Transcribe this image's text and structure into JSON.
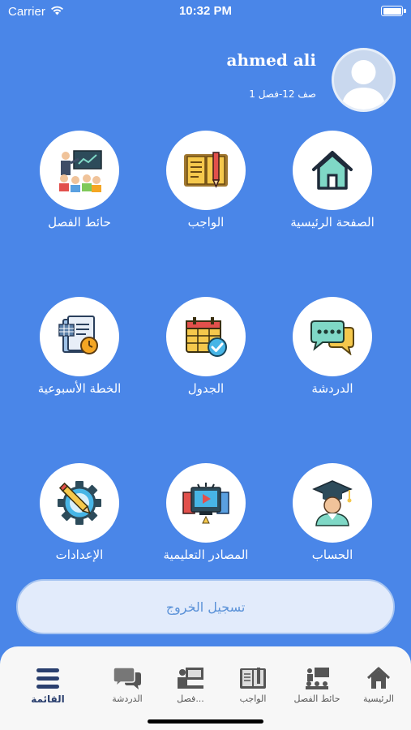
{
  "status_bar": {
    "carrier": "Carrier",
    "time": "10:32 PM"
  },
  "profile": {
    "name": "ahmed ali",
    "class_info": "صف 12-فصل 1"
  },
  "grid": [
    {
      "label": "الصفحة الرئيسية",
      "icon": "home-icon"
    },
    {
      "label": "الواجب",
      "icon": "homework-book-icon"
    },
    {
      "label": "حائط الفصل",
      "icon": "classroom-icon"
    },
    {
      "label": "الدردشة",
      "icon": "chat-icon"
    },
    {
      "label": "الجدول",
      "icon": "calendar-icon"
    },
    {
      "label": "الخطة الأسبوعية",
      "icon": "weekly-plan-icon"
    },
    {
      "label": "الحساب",
      "icon": "graduate-icon"
    },
    {
      "label": "المصادر التعليمية",
      "icon": "learning-resources-icon"
    },
    {
      "label": "الإعدادات",
      "icon": "settings-gear-icon"
    }
  ],
  "logout_label": "تسجيل الخروج",
  "bottom_nav": [
    {
      "label": "الرئيسية",
      "icon": "home-icon"
    },
    {
      "label": "حائط الفصل",
      "icon": "classroom-icon"
    },
    {
      "label": "الواجب",
      "icon": "book-icon"
    },
    {
      "label": "فصل...",
      "icon": "virtual-class-icon"
    },
    {
      "label": "الدردشة",
      "icon": "chat-icon"
    },
    {
      "label": "القائمة",
      "icon": "menu-icon"
    }
  ],
  "colors": {
    "background": "#4a86e8",
    "nav_background": "#f7f7f7",
    "logout_text": "#5b92d8",
    "active_nav": "#2a3f6e"
  }
}
